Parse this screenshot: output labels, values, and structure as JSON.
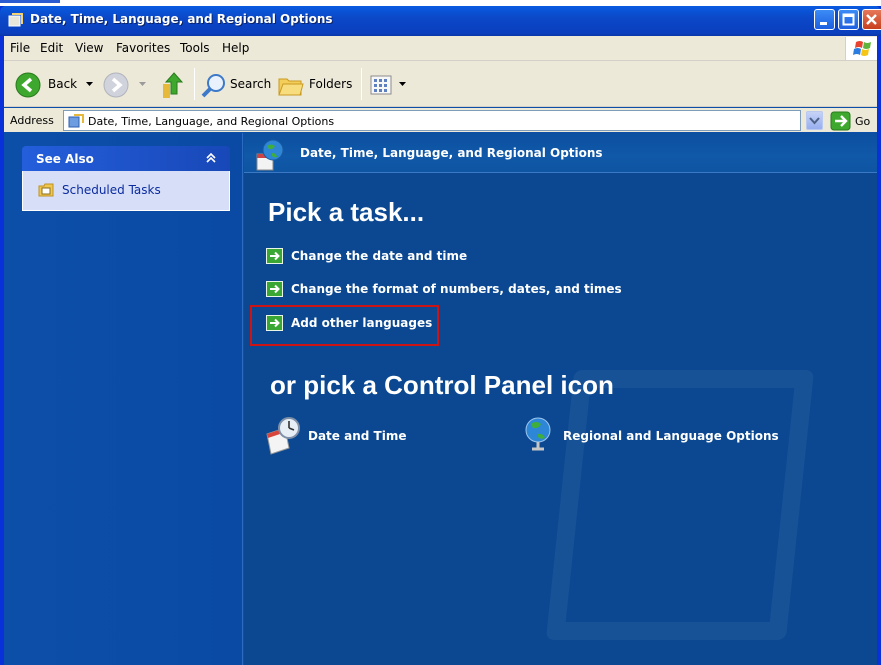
{
  "window": {
    "title": "Date, Time, Language, and Regional Options",
    "buttons": [
      "minimize",
      "maximize",
      "close"
    ]
  },
  "menu": {
    "file": "File",
    "edit": "Edit",
    "view": "View",
    "favorites": "Favorites",
    "tools": "Tools",
    "help": "Help"
  },
  "toolbar": {
    "back_label": "Back",
    "search_label": "Search",
    "folders_label": "Folders"
  },
  "address": {
    "label": "Address",
    "value": "Date, Time, Language, and Regional Options",
    "go_label": "Go"
  },
  "see_also": {
    "title": "See Also",
    "items": [
      "Scheduled Tasks"
    ]
  },
  "content": {
    "header": "Date, Time, Language, and Regional Options",
    "pick_task": "Pick a task...",
    "tasks": [
      "Change the date and time",
      "Change the format of numbers, dates, and times",
      "Add other languages"
    ],
    "highlighted_task": "Add other languages",
    "pick_icon": "or pick a Control Panel icon",
    "icons": [
      "Date and Time",
      "Regional and Language Options"
    ]
  },
  "colors": {
    "titlebar": "#0b48c8",
    "pane": "#0b4891",
    "sidebar": "#0c4fa8",
    "highlight": "#cc1414",
    "task_arrow": "#3aa634"
  }
}
